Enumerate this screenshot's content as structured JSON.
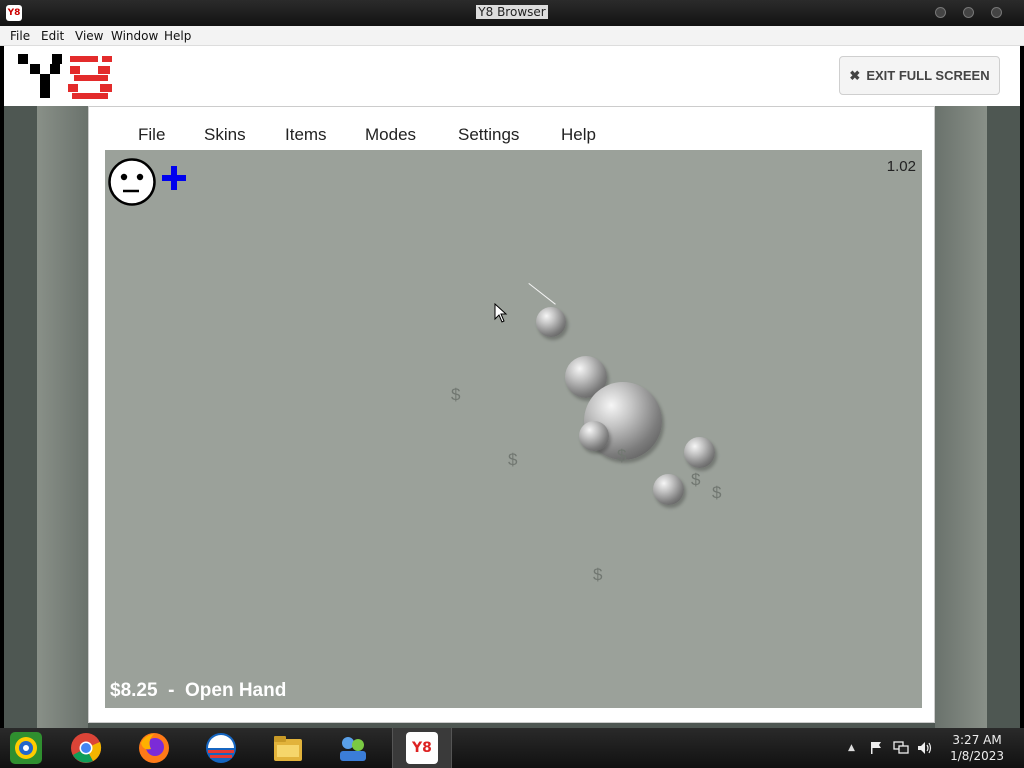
{
  "window": {
    "title": "Y8 Browser",
    "app_icon_label": "Y8"
  },
  "menubar": {
    "items": [
      "File",
      "Edit",
      "View",
      "Window",
      "Help"
    ]
  },
  "header": {
    "logo": "Y8",
    "exit_fullscreen_label": "EXIT FULL SCREEN",
    "exit_icon": "close-icon"
  },
  "game": {
    "menu": [
      "File",
      "Skins",
      "Items",
      "Modes",
      "Settings",
      "Help"
    ],
    "version": "1.02",
    "status": "$8.25  -  Open Hand",
    "dollar_symbol": "$",
    "accent_color": "#0000ee",
    "background_color": "#9ba19a"
  },
  "taskbar": {
    "apps": [
      "start-icon",
      "chrome-icon",
      "firefox-icon",
      "edge-icon",
      "file-explorer-icon",
      "network-icon",
      "y8-icon"
    ],
    "clock_time": "3:27 AM",
    "clock_date": "1/8/2023"
  }
}
